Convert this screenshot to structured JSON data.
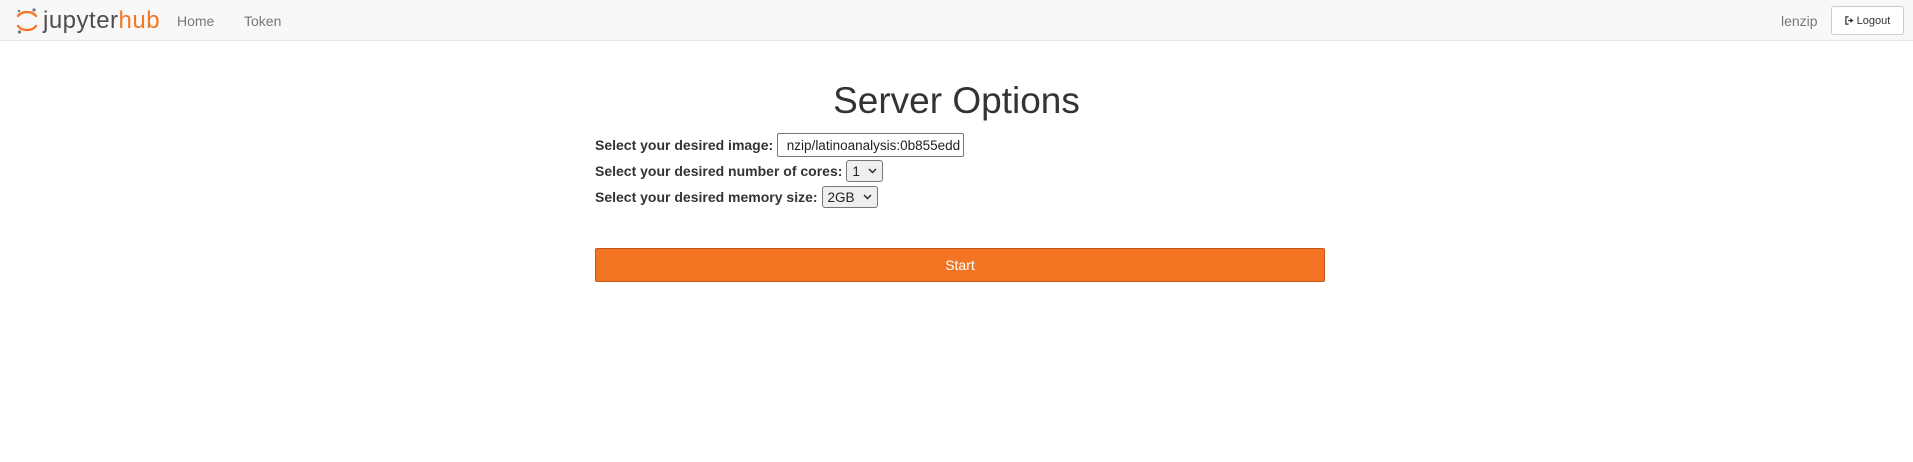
{
  "navbar": {
    "logo": {
      "part1": "jupyter",
      "part2": "hub",
      "icon": "jupyter-logo-icon"
    },
    "links": {
      "home": "Home",
      "token": "Token"
    },
    "user": "lenzip",
    "logout_label": "Logout",
    "logout_icon": "sign-out-icon"
  },
  "main": {
    "title": "Server Options",
    "image": {
      "label": "Select your desired image:",
      "value": "nzip/latinoanalysis:0b855edd"
    },
    "cores": {
      "label": "Select your desired number of cores:",
      "selected": "1"
    },
    "memory": {
      "label": "Select your desired memory size:",
      "selected": "2GB"
    },
    "start_label": "Start"
  },
  "colors": {
    "accent": "#f37524",
    "navbar_bg": "#f8f8f8",
    "hub_text": "#f37726"
  }
}
